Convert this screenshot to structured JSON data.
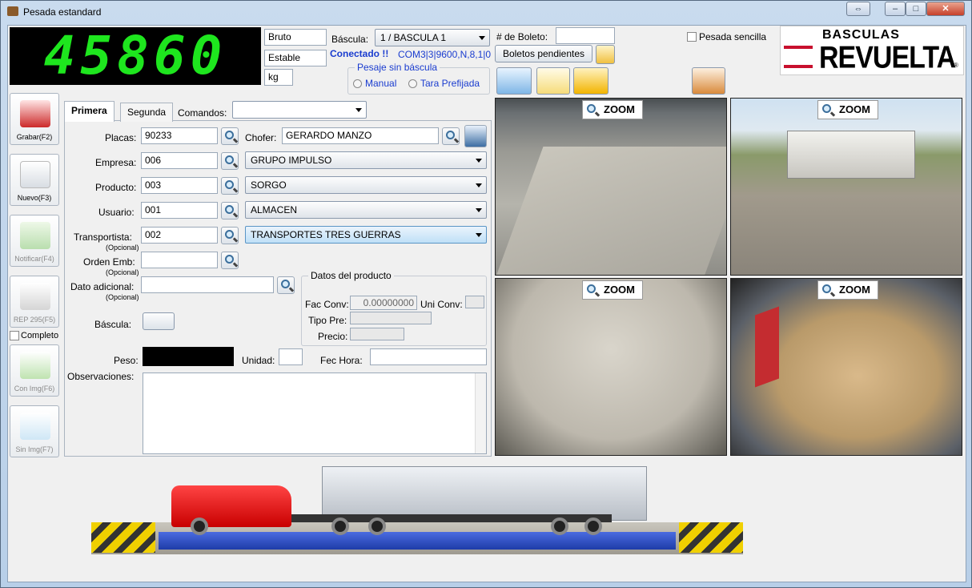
{
  "window": {
    "title": "Pesada estandard",
    "restore_label": "⇔",
    "min_label": "–",
    "max_label": "□",
    "close_label": "✕"
  },
  "display": {
    "weight": "45860",
    "mode": "Bruto",
    "state": "Estable",
    "unit": "kg"
  },
  "bascula": {
    "label": "Báscula:",
    "value": "1 / BASCULA 1",
    "status": "Conectado !!",
    "port": "COM3|3|9600,N,8,1|0"
  },
  "pesaje": {
    "group_title": "Pesaje sin báscula",
    "manual": "Manual",
    "tara": "Tara Prefijada"
  },
  "boleto": {
    "label": "# de Boleto:",
    "value": "",
    "pending": "Boletos pendientes"
  },
  "pesada_sencilla": "Pesada sencilla",
  "logo": {
    "top": "BASCULAS",
    "bottom": "REVUELTA",
    "mark": "®"
  },
  "sidebar": [
    {
      "label": "Grabar(F2)",
      "icon": "truck-save-icon",
      "enabled": true
    },
    {
      "label": "Nuevo(F3)",
      "icon": "new-document-icon",
      "enabled": true
    },
    {
      "label": "Notificar(F4)",
      "icon": "notify-icon",
      "enabled": false
    },
    {
      "label": "REP 295(F5)",
      "icon": "report-printer-icon",
      "enabled": false
    },
    {
      "label": "Con Img(F6)",
      "icon": "printer-image-icon",
      "enabled": false
    },
    {
      "label": "Sin Img(F7)",
      "icon": "printer-icon",
      "enabled": false
    }
  ],
  "completo": "Completo",
  "tabs": {
    "primera": "Primera",
    "segunda": "Segunda",
    "comandos": "Comandos:",
    "comandos_value": ""
  },
  "form": {
    "placas": {
      "label": "Placas:",
      "value": "90233"
    },
    "chofer": {
      "label": "Chofer:",
      "value": "GERARDO MANZO"
    },
    "empresa": {
      "label": "Empresa:",
      "code": "006",
      "name": "GRUPO IMPULSO"
    },
    "producto": {
      "label": "Producto:",
      "code": "003",
      "name": "SORGO"
    },
    "usuario": {
      "label": "Usuario:",
      "code": "001",
      "name": "ALMACEN"
    },
    "transportista": {
      "label": "Transportista:",
      "code": "002",
      "name": "TRANSPORTES TRES GUERRAS"
    },
    "orden": {
      "label": "Orden Emb:",
      "value": ""
    },
    "dato": {
      "label": "Dato adicional:",
      "value": ""
    },
    "opcional": "(Opcional)",
    "bascula": {
      "label": "Báscula:"
    },
    "peso": {
      "label": "Peso:"
    },
    "unidad": {
      "label": "Unidad:",
      "value": ""
    },
    "fec": {
      "label": "Fec Hora:",
      "value": ""
    },
    "obs": {
      "label": "Observaciones:"
    }
  },
  "datos_producto": {
    "title": "Datos del producto",
    "fac_label": "Fac Conv:",
    "fac_value": "0.00000000",
    "uni_label": "Uni Conv:",
    "tipo_label": "Tipo Pre:",
    "precio_label": "Precio:"
  },
  "cams": {
    "zoom": "ZOOM"
  }
}
